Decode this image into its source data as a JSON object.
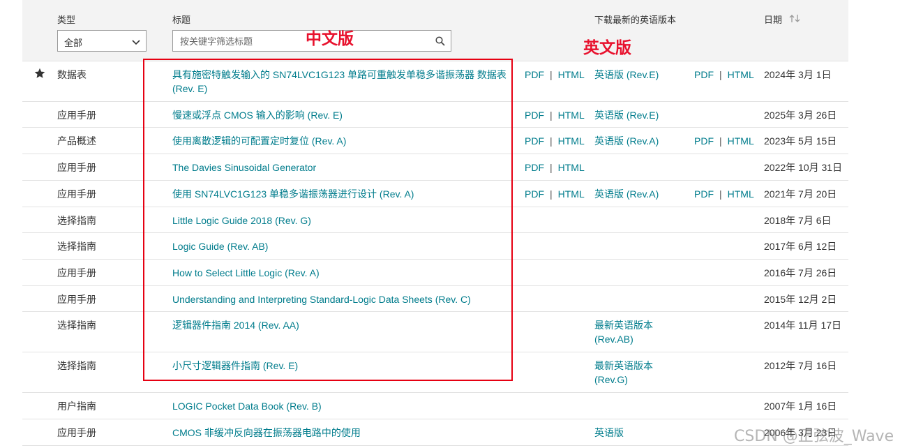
{
  "header": {
    "type_label": "类型",
    "title_label": "标题",
    "download_label": "下载最新的英语版本",
    "date_label": "日期",
    "sort_icon": "sort-arrows-icon",
    "type_select_value": "全部",
    "search_placeholder": "按关键字筛选标题"
  },
  "annotations": {
    "chinese_version": "中文版",
    "english_version": "英文版"
  },
  "fmt": {
    "pdf": "PDF",
    "sep": "|",
    "html": "HTML"
  },
  "rows": [
    {
      "type": "数据表",
      "title": "具有施密特触发输入的 SN74LVC1G123 单路可重触发单稳多谐振荡器 数据表 (Rev. E)",
      "english": "英语版 (Rev.E)",
      "date": "2024年 3月 1日"
    },
    {
      "type": "应用手册",
      "title": "慢速或浮点 CMOS 输入的影响 (Rev. E)",
      "english": "英语版 (Rev.E)",
      "date": "2025年 3月 26日"
    },
    {
      "type": "产品概述",
      "title": "使用离散逻辑的可配置定时复位 (Rev. A)",
      "english": "英语版 (Rev.A)",
      "date": "2023年 5月 15日"
    },
    {
      "type": "应用手册",
      "title": "The Davies Sinusoidal Generator",
      "english": "",
      "date": "2022年 10月 31日"
    },
    {
      "type": "应用手册",
      "title": "使用 SN74LVC1G123 单稳多谐振荡器进行设计 (Rev. A)",
      "english": "英语版 (Rev.A)",
      "date": "2021年 7月 20日"
    },
    {
      "type": "选择指南",
      "title": "Little Logic Guide 2018 (Rev. G)",
      "english": "",
      "date": "2018年 7月 6日"
    },
    {
      "type": "选择指南",
      "title": "Logic Guide (Rev. AB)",
      "english": "",
      "date": "2017年 6月 12日"
    },
    {
      "type": "应用手册",
      "title": "How to Select Little Logic (Rev. A)",
      "english": "",
      "date": "2016年 7月 26日"
    },
    {
      "type": "应用手册",
      "title": "Understanding and Interpreting Standard-Logic Data Sheets (Rev. C)",
      "english": "",
      "date": "2015年 12月 2日"
    },
    {
      "type": "选择指南",
      "title": "逻辑器件指南 2014 (Rev. AA)",
      "english": "最新英语版本 (Rev.AB)",
      "date": "2014年 11月 17日"
    },
    {
      "type": "选择指南",
      "title": "小尺寸逻辑器件指南 (Rev. E)",
      "english": "最新英语版本 (Rev.G)",
      "date": "2012年 7月 16日"
    },
    {
      "type": "用户指南",
      "title": "LOGIC Pocket Data Book (Rev. B)",
      "english": "",
      "date": "2007年 1月 16日"
    },
    {
      "type": "应用手册",
      "title": "CMOS 非缓冲反向器在振荡器电路中的使用",
      "english": "英语版",
      "date": "2006年 3月 23日"
    }
  ],
  "watermark": "CSDN @正弦波_Wave"
}
